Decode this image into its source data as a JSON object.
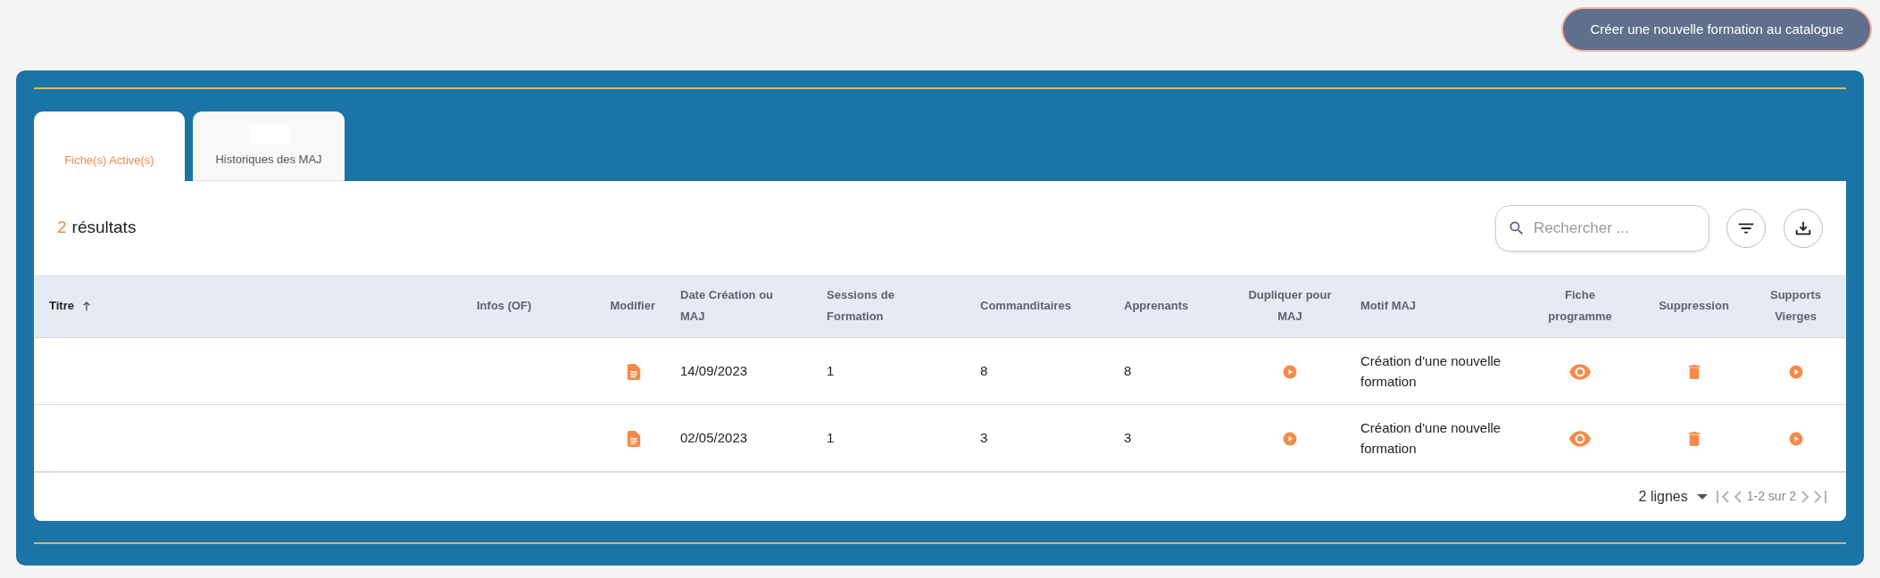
{
  "create_button": {
    "label": "Créer une nouvelle formation au catalogue"
  },
  "tabs": [
    {
      "label": "Fiche(s) Active(s)",
      "selected": true
    },
    {
      "label": "Historiques des MAJ",
      "selected": false
    }
  ],
  "results": {
    "count": "2",
    "label": "résultats"
  },
  "search": {
    "placeholder": "Rechercher ..."
  },
  "table": {
    "columns": [
      {
        "label": "Titre",
        "sorted_ascending": true
      },
      {
        "label": "Infos (OF)"
      },
      {
        "label": "Modifier"
      },
      {
        "label": "Date Création ou MAJ"
      },
      {
        "label": "Sessions de Formation"
      },
      {
        "label": "Commanditaires"
      },
      {
        "label": "Apprenants"
      },
      {
        "label": "Dupliquer pour MAJ"
      },
      {
        "label": "Motif MAJ"
      },
      {
        "label": "Fiche programme"
      },
      {
        "label": "Suppression"
      },
      {
        "label": "Supports Vierges"
      }
    ],
    "rows": [
      {
        "cells": [
          {
            "kind": "empty"
          },
          {
            "kind": "empty"
          },
          {
            "kind": "doc"
          },
          {
            "kind": "text",
            "text": "14/09/2023"
          },
          {
            "kind": "text",
            "text": "1"
          },
          {
            "kind": "text",
            "text": "8"
          },
          {
            "kind": "text",
            "text": "8"
          },
          {
            "kind": "play"
          },
          {
            "kind": "text",
            "text": "Création d'une nouvelle formation"
          },
          {
            "kind": "eye"
          },
          {
            "kind": "trash"
          },
          {
            "kind": "play"
          }
        ]
      },
      {
        "cells": [
          {
            "kind": "empty"
          },
          {
            "kind": "empty"
          },
          {
            "kind": "doc"
          },
          {
            "kind": "text",
            "text": "02/05/2023"
          },
          {
            "kind": "text",
            "text": "1"
          },
          {
            "kind": "text",
            "text": "3"
          },
          {
            "kind": "text",
            "text": "3"
          },
          {
            "kind": "play"
          },
          {
            "kind": "text",
            "text": "Création d'une nouvelle formation"
          },
          {
            "kind": "eye"
          },
          {
            "kind": "trash"
          },
          {
            "kind": "play"
          }
        ]
      }
    ]
  },
  "pagination": {
    "rows_per_page": "2 lignes",
    "range": "1-2 sur 2",
    "first_disabled": true,
    "prev_disabled": true,
    "next_disabled": true,
    "last_disabled": true
  }
}
